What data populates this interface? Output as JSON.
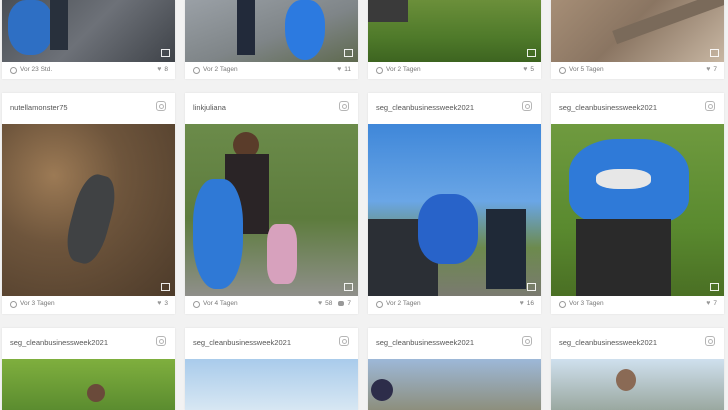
{
  "cards": [
    {
      "username": "",
      "time": "Vor 23 Std.",
      "likes": "8",
      "comments": ""
    },
    {
      "username": "",
      "time": "Vor 2 Tagen",
      "likes": "11",
      "comments": ""
    },
    {
      "username": "",
      "time": "Vor 2 Tagen",
      "likes": "5",
      "comments": ""
    },
    {
      "username": "",
      "time": "Vor 5 Tagen",
      "likes": "7",
      "comments": ""
    },
    {
      "username": "nutellamonster75",
      "time": "Vor 3 Tagen",
      "likes": "3",
      "comments": ""
    },
    {
      "username": "linkjuliana",
      "time": "Vor 4 Tagen",
      "likes": "58",
      "comments": "7"
    },
    {
      "username": "seg_cleanbusinessweek2021",
      "time": "Vor 2 Tagen",
      "likes": "16",
      "comments": ""
    },
    {
      "username": "seg_cleanbusinessweek2021",
      "time": "Vor 3 Tagen",
      "likes": "7",
      "comments": ""
    },
    {
      "username": "seg_cleanbusinessweek2021",
      "time": "",
      "likes": "",
      "comments": ""
    },
    {
      "username": "seg_cleanbusinessweek2021",
      "time": "",
      "likes": "",
      "comments": ""
    },
    {
      "username": "seg_cleanbusinessweek2021",
      "time": "",
      "likes": "",
      "comments": ""
    },
    {
      "username": "seg_cleanbusinessweek2021",
      "time": "",
      "likes": "",
      "comments": ""
    }
  ],
  "icons": {
    "instagram": "instagram-icon",
    "clock": "clock-icon",
    "heart": "heart-icon",
    "comment": "comment-icon",
    "gallery": "gallery-icon"
  }
}
